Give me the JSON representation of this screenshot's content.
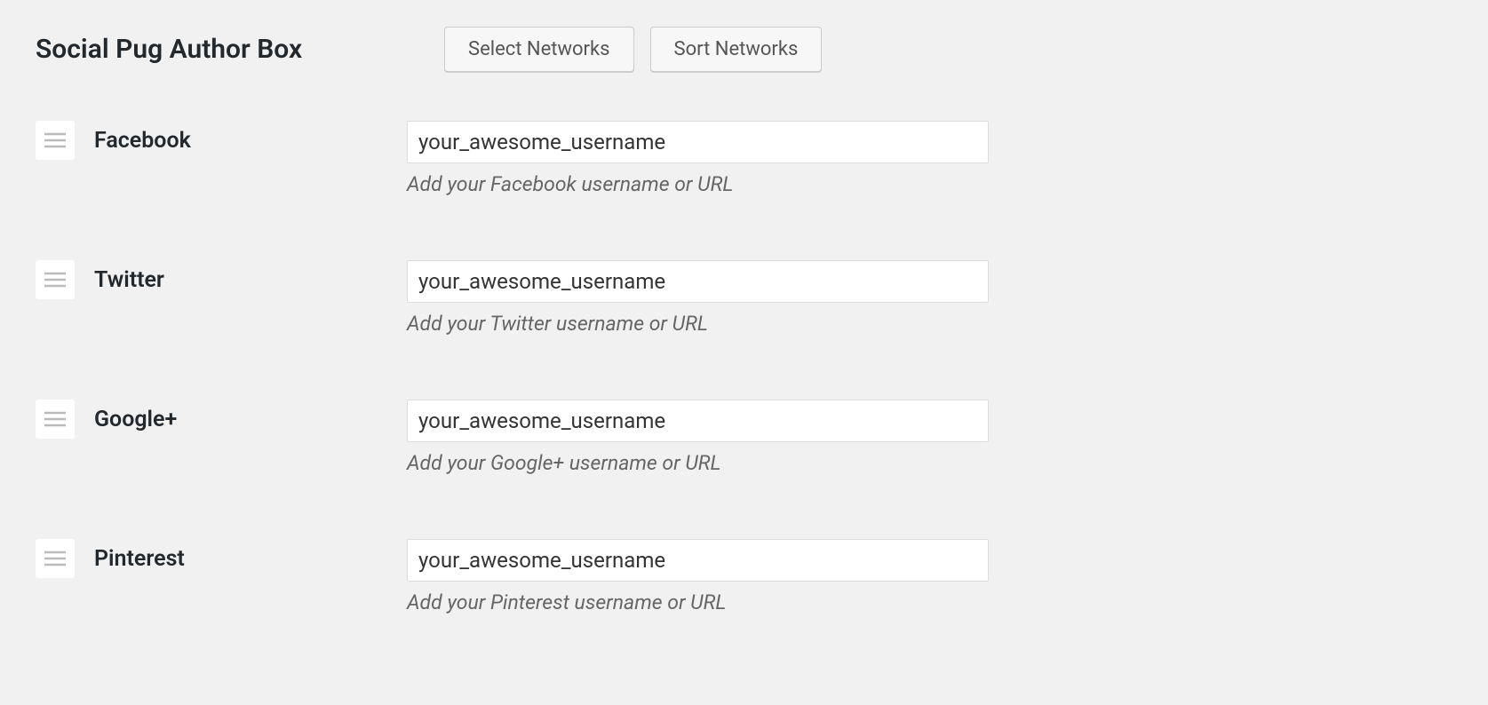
{
  "header": {
    "title": "Social Pug Author Box",
    "buttons": {
      "select": "Select Networks",
      "sort": "Sort Networks"
    }
  },
  "networks": [
    {
      "label": "Facebook",
      "value": "your_awesome_username",
      "hint": "Add your Facebook username or URL"
    },
    {
      "label": "Twitter",
      "value": "your_awesome_username",
      "hint": "Add your Twitter username or URL"
    },
    {
      "label": "Google+",
      "value": "your_awesome_username",
      "hint": "Add your Google+ username or URL"
    },
    {
      "label": "Pinterest",
      "value": "your_awesome_username",
      "hint": "Add your Pinterest username or URL"
    }
  ]
}
